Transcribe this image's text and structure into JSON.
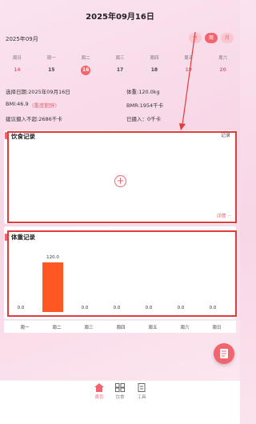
{
  "header": {
    "title": "2025年09月16日",
    "month": "2025年09月",
    "toggle": [
      "今",
      "周",
      "月"
    ]
  },
  "week": [
    {
      "name": "周日",
      "date": "14"
    },
    {
      "name": "周一",
      "date": "15"
    },
    {
      "name": "周二",
      "date": "16"
    },
    {
      "name": "周三",
      "date": "17"
    },
    {
      "name": "周四",
      "date": "18"
    },
    {
      "name": "周五",
      "date": "19"
    },
    {
      "name": "周六",
      "date": "20"
    }
  ],
  "info": {
    "selected_date": "选择日期:2025年09月16日",
    "weight": "体重:120.0kg",
    "bmi": "BMI:46.9",
    "bmi_status": "(重度肥胖)",
    "bmr": "BMR:1954千卡",
    "suggest": "建议摄入不超:2686千卡",
    "intake": "已摄入：0千卡"
  },
  "diet": {
    "title": "饮食记录",
    "link": "记录",
    "detail": "详情",
    "plus": "+"
  },
  "weight_chart": {
    "title": "体重记录",
    "days": [
      "周一",
      "周二",
      "周三",
      "周四",
      "周五",
      "周六",
      "周日"
    ]
  },
  "chart_data": {
    "type": "bar",
    "categories": [
      "周一",
      "周二",
      "周三",
      "周四",
      "周五",
      "周六",
      "周日"
    ],
    "values": [
      0.0,
      120.0,
      0.0,
      0.0,
      0.0,
      0.0,
      0.0
    ],
    "value_labels": [
      "0.0",
      "120.0",
      "0.0",
      "0.0",
      "0.0",
      "0.0",
      "0.0"
    ],
    "color": "#ff5722"
  },
  "tabbar": [
    {
      "label": "首页",
      "icon": "home-icon",
      "active": true
    },
    {
      "label": "饮食",
      "icon": "grid-icon",
      "active": false
    },
    {
      "label": "工具",
      "icon": "document-icon",
      "active": false
    }
  ],
  "colors": {
    "accent": "#f2656f",
    "highlight": "#e23b3b",
    "bar": "#ff5722"
  }
}
